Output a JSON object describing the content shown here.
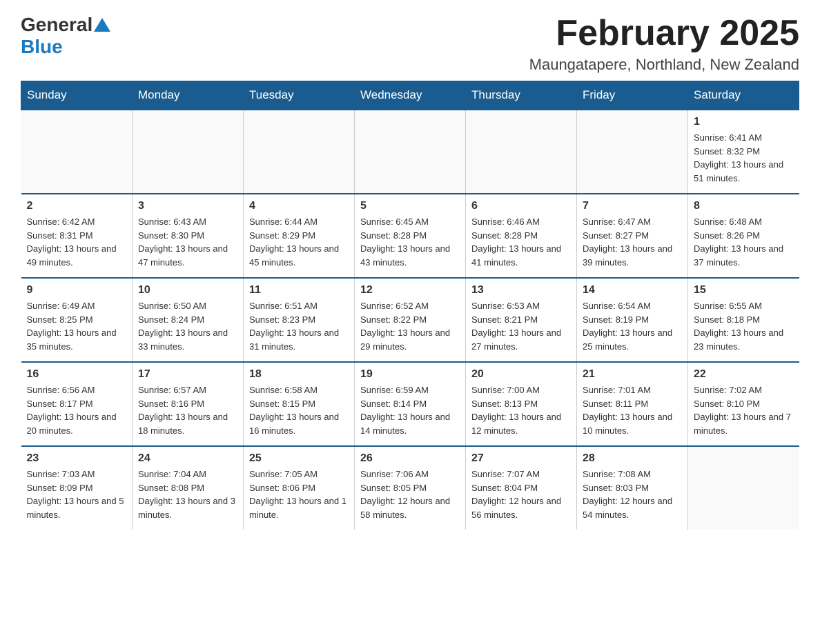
{
  "logo": {
    "general": "General",
    "blue": "Blue"
  },
  "title": "February 2025",
  "subtitle": "Maungatapere, Northland, New Zealand",
  "days_of_week": [
    "Sunday",
    "Monday",
    "Tuesday",
    "Wednesday",
    "Thursday",
    "Friday",
    "Saturday"
  ],
  "weeks": [
    [
      {
        "day": null,
        "info": null
      },
      {
        "day": null,
        "info": null
      },
      {
        "day": null,
        "info": null
      },
      {
        "day": null,
        "info": null
      },
      {
        "day": null,
        "info": null
      },
      {
        "day": null,
        "info": null
      },
      {
        "day": "1",
        "info": "Sunrise: 6:41 AM\nSunset: 8:32 PM\nDaylight: 13 hours and 51 minutes."
      }
    ],
    [
      {
        "day": "2",
        "info": "Sunrise: 6:42 AM\nSunset: 8:31 PM\nDaylight: 13 hours and 49 minutes."
      },
      {
        "day": "3",
        "info": "Sunrise: 6:43 AM\nSunset: 8:30 PM\nDaylight: 13 hours and 47 minutes."
      },
      {
        "day": "4",
        "info": "Sunrise: 6:44 AM\nSunset: 8:29 PM\nDaylight: 13 hours and 45 minutes."
      },
      {
        "day": "5",
        "info": "Sunrise: 6:45 AM\nSunset: 8:28 PM\nDaylight: 13 hours and 43 minutes."
      },
      {
        "day": "6",
        "info": "Sunrise: 6:46 AM\nSunset: 8:28 PM\nDaylight: 13 hours and 41 minutes."
      },
      {
        "day": "7",
        "info": "Sunrise: 6:47 AM\nSunset: 8:27 PM\nDaylight: 13 hours and 39 minutes."
      },
      {
        "day": "8",
        "info": "Sunrise: 6:48 AM\nSunset: 8:26 PM\nDaylight: 13 hours and 37 minutes."
      }
    ],
    [
      {
        "day": "9",
        "info": "Sunrise: 6:49 AM\nSunset: 8:25 PM\nDaylight: 13 hours and 35 minutes."
      },
      {
        "day": "10",
        "info": "Sunrise: 6:50 AM\nSunset: 8:24 PM\nDaylight: 13 hours and 33 minutes."
      },
      {
        "day": "11",
        "info": "Sunrise: 6:51 AM\nSunset: 8:23 PM\nDaylight: 13 hours and 31 minutes."
      },
      {
        "day": "12",
        "info": "Sunrise: 6:52 AM\nSunset: 8:22 PM\nDaylight: 13 hours and 29 minutes."
      },
      {
        "day": "13",
        "info": "Sunrise: 6:53 AM\nSunset: 8:21 PM\nDaylight: 13 hours and 27 minutes."
      },
      {
        "day": "14",
        "info": "Sunrise: 6:54 AM\nSunset: 8:19 PM\nDaylight: 13 hours and 25 minutes."
      },
      {
        "day": "15",
        "info": "Sunrise: 6:55 AM\nSunset: 8:18 PM\nDaylight: 13 hours and 23 minutes."
      }
    ],
    [
      {
        "day": "16",
        "info": "Sunrise: 6:56 AM\nSunset: 8:17 PM\nDaylight: 13 hours and 20 minutes."
      },
      {
        "day": "17",
        "info": "Sunrise: 6:57 AM\nSunset: 8:16 PM\nDaylight: 13 hours and 18 minutes."
      },
      {
        "day": "18",
        "info": "Sunrise: 6:58 AM\nSunset: 8:15 PM\nDaylight: 13 hours and 16 minutes."
      },
      {
        "day": "19",
        "info": "Sunrise: 6:59 AM\nSunset: 8:14 PM\nDaylight: 13 hours and 14 minutes."
      },
      {
        "day": "20",
        "info": "Sunrise: 7:00 AM\nSunset: 8:13 PM\nDaylight: 13 hours and 12 minutes."
      },
      {
        "day": "21",
        "info": "Sunrise: 7:01 AM\nSunset: 8:11 PM\nDaylight: 13 hours and 10 minutes."
      },
      {
        "day": "22",
        "info": "Sunrise: 7:02 AM\nSunset: 8:10 PM\nDaylight: 13 hours and 7 minutes."
      }
    ],
    [
      {
        "day": "23",
        "info": "Sunrise: 7:03 AM\nSunset: 8:09 PM\nDaylight: 13 hours and 5 minutes."
      },
      {
        "day": "24",
        "info": "Sunrise: 7:04 AM\nSunset: 8:08 PM\nDaylight: 13 hours and 3 minutes."
      },
      {
        "day": "25",
        "info": "Sunrise: 7:05 AM\nSunset: 8:06 PM\nDaylight: 13 hours and 1 minute."
      },
      {
        "day": "26",
        "info": "Sunrise: 7:06 AM\nSunset: 8:05 PM\nDaylight: 12 hours and 58 minutes."
      },
      {
        "day": "27",
        "info": "Sunrise: 7:07 AM\nSunset: 8:04 PM\nDaylight: 12 hours and 56 minutes."
      },
      {
        "day": "28",
        "info": "Sunrise: 7:08 AM\nSunset: 8:03 PM\nDaylight: 12 hours and 54 minutes."
      },
      {
        "day": null,
        "info": null
      }
    ]
  ]
}
